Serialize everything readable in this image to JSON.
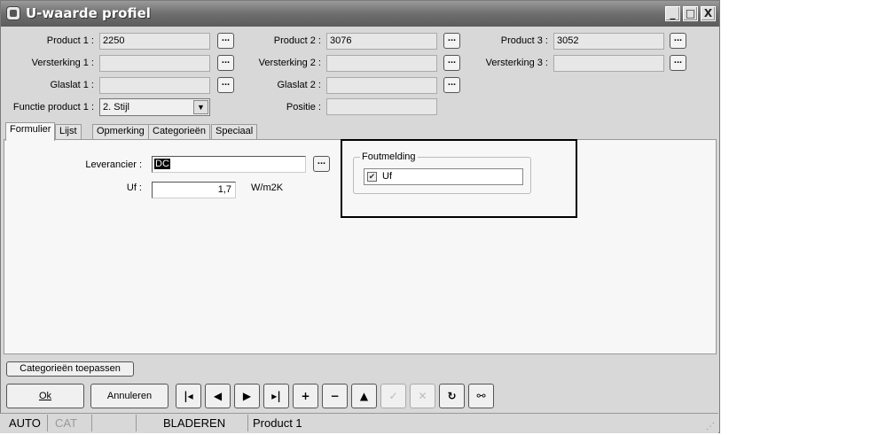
{
  "window": {
    "title": "U-waarde profiel"
  },
  "titlebar_buttons": {
    "minimize": "_",
    "maximize": "□",
    "close": "X"
  },
  "header": {
    "product1_label": "Product 1 :",
    "product1_value": "2250",
    "product2_label": "Product 2 :",
    "product2_value": "3076",
    "product3_label": "Product 3 :",
    "product3_value": "3052",
    "versterking1_label": "Versterking 1 :",
    "versterking1_value": "",
    "versterking2_label": "Versterking 2 :",
    "versterking2_value": "",
    "versterking3_label": "Versterking 3 :",
    "versterking3_value": "",
    "glaslat1_label": "Glaslat 1 :",
    "glaslat1_value": "",
    "glaslat2_label": "Glaslat 2 :",
    "glaslat2_value": "",
    "functie_label": "Functie product 1 :",
    "functie_value": "2.  Stijl",
    "positie_label": "Positie :",
    "positie_value": "",
    "browse_label": "..."
  },
  "tabs": [
    "Formulier",
    "Lijst",
    "Opmerking",
    "Categorieën",
    "Speciaal"
  ],
  "form": {
    "leverancier_label": "Leverancier :",
    "leverancier_value": "DC",
    "uf_label": "Uf :",
    "uf_value": "1,7",
    "uf_unit": "W/m2K"
  },
  "foutmelding": {
    "title": "Foutmelding",
    "item_label": "Uf",
    "item_checked": true
  },
  "buttons": {
    "apply_categories": "Categorieën toepassen",
    "ok": "Ok",
    "cancel": "Annuleren"
  },
  "nav_icons": [
    "first-record-icon",
    "previous-record-icon",
    "next-record-icon",
    "last-record-icon",
    "add-icon",
    "delete-icon",
    "up-icon",
    "confirm-icon",
    "discard-icon",
    "refresh-icon",
    "search-binoculars-icon"
  ],
  "statusbar": {
    "mode1": "AUTO",
    "mode2": "CAT",
    "state": "BLADEREN",
    "record": "Product 1"
  }
}
